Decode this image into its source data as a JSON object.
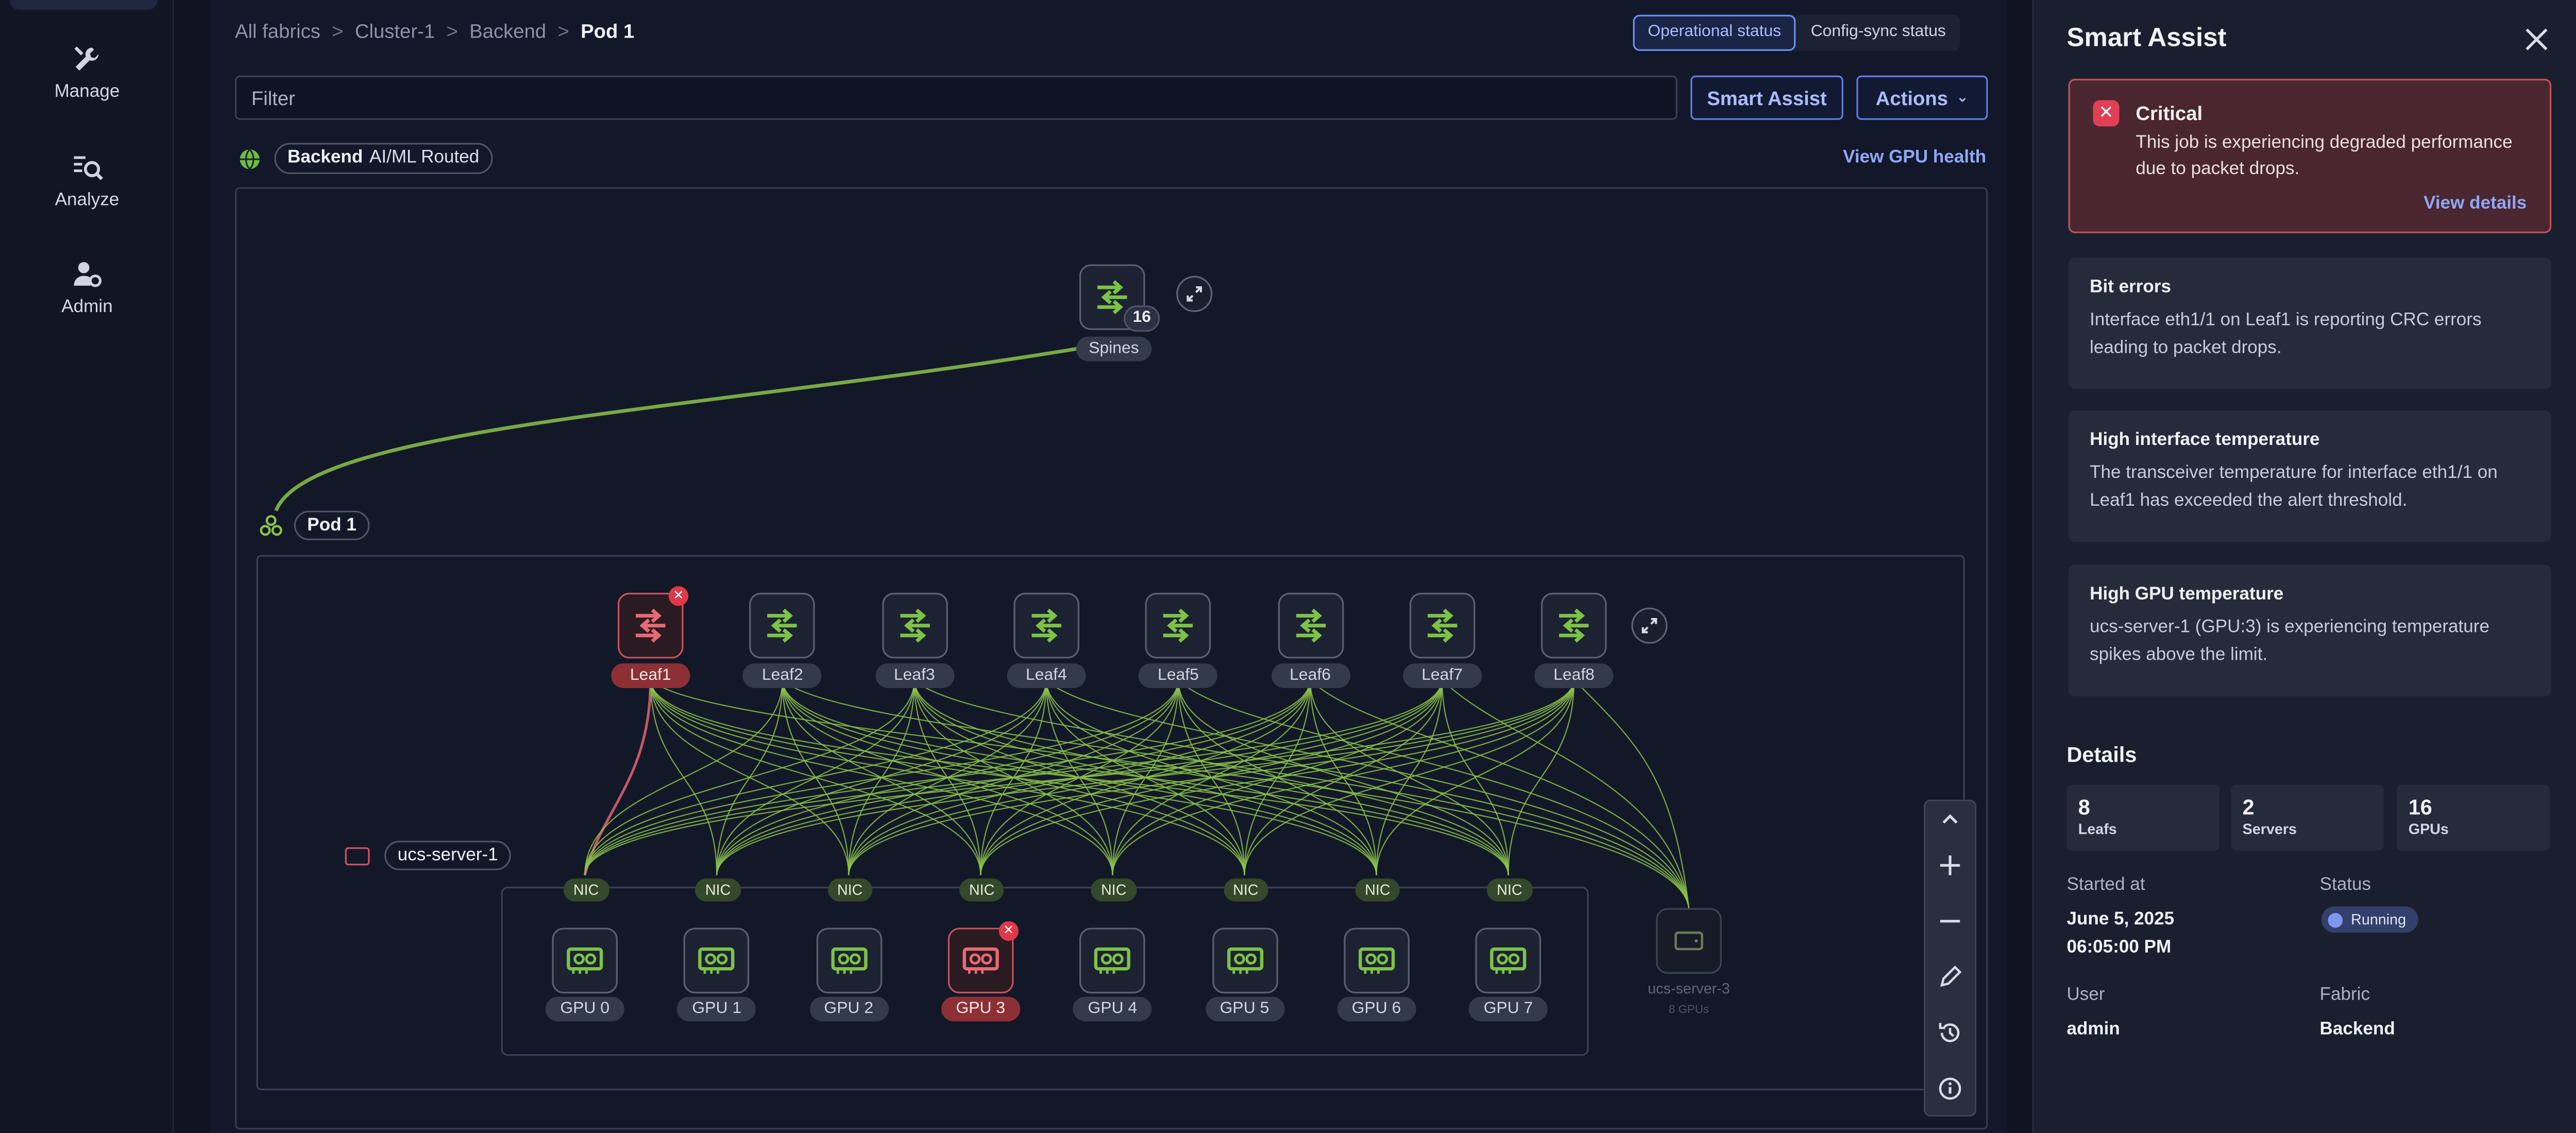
{
  "nav": {
    "items": [
      {
        "label": "Manage",
        "icon": "wrench-icon"
      },
      {
        "label": "Analyze",
        "icon": "search-list-icon"
      },
      {
        "label": "Admin",
        "icon": "admin-user-icon"
      }
    ]
  },
  "breadcrumb": {
    "items": [
      "All fabrics",
      "Cluster-1",
      "Backend"
    ],
    "current": "Pod 1",
    "separator": ">"
  },
  "status_toggle": {
    "operational": "Operational status",
    "config_sync": "Config-sync status",
    "selected": "Operational status"
  },
  "toolbar": {
    "filter_placeholder": "Filter",
    "smart_assist_label": "Smart Assist",
    "actions_label": "Actions"
  },
  "fabric": {
    "name": "Backend",
    "type": "AI/ML Routed",
    "view_gpu_health": "View GPU health"
  },
  "topology": {
    "spines": {
      "label": "Spines",
      "count": "16"
    },
    "pod": {
      "label": "Pod 1"
    },
    "leafs": [
      {
        "label": "Leaf1",
        "status": "error"
      },
      {
        "label": "Leaf2",
        "status": "ok"
      },
      {
        "label": "Leaf3",
        "status": "ok"
      },
      {
        "label": "Leaf4",
        "status": "ok"
      },
      {
        "label": "Leaf5",
        "status": "ok"
      },
      {
        "label": "Leaf6",
        "status": "ok"
      },
      {
        "label": "Leaf7",
        "status": "ok"
      },
      {
        "label": "Leaf8",
        "status": "ok"
      }
    ],
    "server": {
      "label": "ucs-server-1"
    },
    "nics": [
      "NIC",
      "NIC",
      "NIC",
      "NIC",
      "NIC",
      "NIC",
      "NIC",
      "NIC"
    ],
    "gpus": [
      {
        "label": "GPU 0",
        "status": "ok"
      },
      {
        "label": "GPU 1",
        "status": "ok"
      },
      {
        "label": "GPU 2",
        "status": "ok"
      },
      {
        "label": "GPU 3",
        "status": "error"
      },
      {
        "label": "GPU 4",
        "status": "ok"
      },
      {
        "label": "GPU 5",
        "status": "ok"
      },
      {
        "label": "GPU 6",
        "status": "ok"
      },
      {
        "label": "GPU 7",
        "status": "ok"
      }
    ],
    "other_server": {
      "label": "ucs-server-3",
      "sub": "8 GPUs"
    }
  },
  "colors": {
    "link_ok": "#8bc34a",
    "link_error": "#e06470",
    "accent": "#6f8ff0",
    "critical": "#e04055"
  },
  "smart_assist": {
    "title": "Smart Assist",
    "critical": {
      "title": "Critical",
      "body": "This job is experiencing degraded performance due to packet drops.",
      "link": "View details"
    },
    "issues": [
      {
        "title": "Bit errors",
        "body": "Interface eth1/1 on Leaf1 is reporting CRC errors leading to packet drops."
      },
      {
        "title": "High interface temperature",
        "body": "The transceiver temperature for interface eth1/1 on Leaf1 has exceeded the alert threshold."
      },
      {
        "title": "High GPU temperature",
        "body": "ucs-server-1 (GPU:3) is experiencing temperature spikes above the limit."
      }
    ],
    "details": {
      "title": "Details",
      "stats": [
        {
          "value": "8",
          "label": "Leafs"
        },
        {
          "value": "2",
          "label": "Servers"
        },
        {
          "value": "16",
          "label": "GPUs"
        }
      ],
      "started_at_label": "Started at",
      "started_at_date": "June 5, 2025",
      "started_at_time": "06:05:00 PM",
      "status_label": "Status",
      "status_value": "Running",
      "user_label": "User",
      "user_value": "admin",
      "fabric_label": "Fabric",
      "fabric_value": "Backend"
    }
  }
}
